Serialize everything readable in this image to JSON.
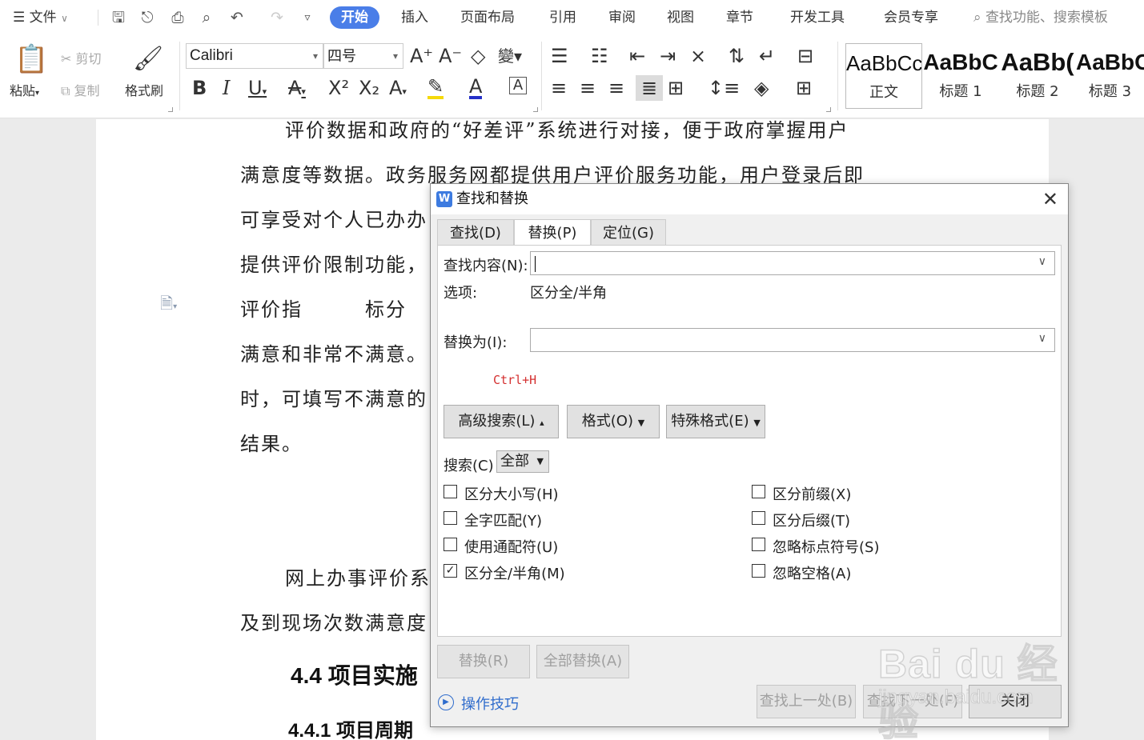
{
  "tabbar": {
    "file_label": "文件",
    "tabs": [
      "开始",
      "插入",
      "页面布局",
      "引用",
      "审阅",
      "视图",
      "章节",
      "开发工具",
      "会员专享"
    ],
    "active_tab": "开始",
    "search_placeholder": "查找功能、搜索模板"
  },
  "ribbon": {
    "paste_label": "粘贴",
    "cut_label": "剪切",
    "copy_label": "复制",
    "format_painter_label": "格式刷",
    "font_name": "Calibri",
    "font_size": "四号",
    "styles": [
      {
        "sample": "AaBbCcI",
        "name": "正文"
      },
      {
        "sample": "AaBbC",
        "name": "标题 1"
      },
      {
        "sample": "AaBb(",
        "name": "标题 2"
      },
      {
        "sample": "AaBbC",
        "name": "标题 3"
      }
    ]
  },
  "document": {
    "lines": [
      "评价数据和政府的“好差评”系统进行对接，便于政府掌握用户",
      "满意度等数据。政务服务网都提供用户评价服务功能，用户登录后即",
      "可享受对个人已办办",
      "提供评价限制功能，",
      "评价指　　　标分",
      "满意和非常不满意。",
      "时，可填写不满意的",
      "结果。",
      "网上办事评价系",
      "及到现场次数满意度"
    ],
    "heading1": "4.4 项目实施",
    "heading2": "4.4.1 项目周期"
  },
  "dialog": {
    "title": "查找和替换",
    "tabs": [
      "查找(D)",
      "替换(P)",
      "定位(G)"
    ],
    "active_tab": "替换(P)",
    "find_label": "查找内容(N):",
    "find_value": "",
    "options_label": "选项:",
    "options_value": "区分全/半角",
    "replace_label": "替换为(I):",
    "replace_value": "",
    "shortcut_hint": "Ctrl+H",
    "advanced_button": "高级搜索(L)",
    "format_button": "格式(O)",
    "special_button": "特殊格式(E)",
    "search_label": "搜索(C)",
    "search_scope": "全部",
    "checkboxes_left": [
      {
        "label": "区分大小写(H)",
        "checked": false
      },
      {
        "label": "全字匹配(Y)",
        "checked": false
      },
      {
        "label": "使用通配符(U)",
        "checked": false
      },
      {
        "label": "区分全/半角(M)",
        "checked": true
      }
    ],
    "checkboxes_right": [
      {
        "label": "区分前缀(X)",
        "checked": false
      },
      {
        "label": "区分后缀(T)",
        "checked": false
      },
      {
        "label": "忽略标点符号(S)",
        "checked": false
      },
      {
        "label": "忽略空格(A)",
        "checked": false
      }
    ],
    "replace_button": "替换(R)",
    "replace_all_button": "全部替换(A)",
    "tips_link": "操作技巧",
    "find_prev_button": "查找上一处(B)",
    "find_next_button": "查找下一处(F)",
    "close_button": "关闭"
  },
  "watermark": {
    "big": "Bai du 经验",
    "small": "jingyan.baidu.com"
  }
}
